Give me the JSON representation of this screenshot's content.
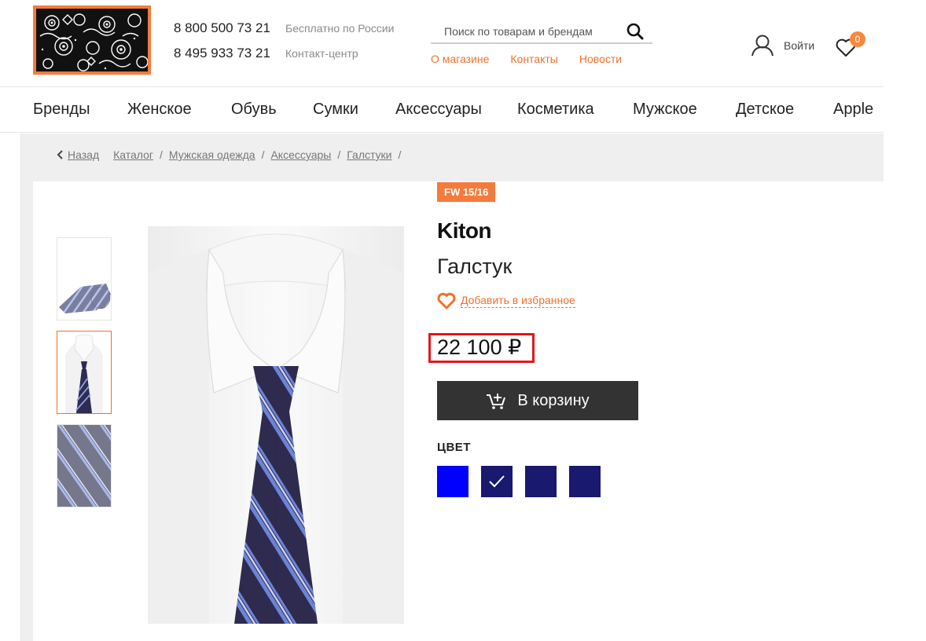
{
  "header": {
    "phones": [
      {
        "number": "8 800 500 73 21",
        "note": "Бесплатно по России"
      },
      {
        "number": "8 495 933 73 21",
        "note": "Контакт-центр"
      }
    ],
    "search": {
      "placeholder": "Поиск по товарам и брендам"
    },
    "links": [
      "О магазине",
      "Контакты",
      "Новости"
    ],
    "login_label": "Войти",
    "favorites_count": "0",
    "accent_color": "#f47b3b"
  },
  "nav": {
    "items": [
      "Бренды",
      "Женское",
      "Обувь",
      "Сумки",
      "Аксессуары",
      "Косметика",
      "Мужское",
      "Детское",
      "Apple"
    ]
  },
  "breadcrumb": {
    "back": "Назад",
    "items": [
      "Каталог",
      "Мужская одежда",
      "Аксессуары",
      "Галстуки"
    ],
    "separator": "/"
  },
  "product": {
    "season": "FW 15/16",
    "brand": "Kiton",
    "name": "Галстук",
    "add_favorite": "Добавить в избранное",
    "price": "22 100 ₽",
    "cart_label": "В корзину",
    "color_label": "ЦВЕТ",
    "colors": [
      {
        "hex": "#0000ff",
        "selected": false
      },
      {
        "hex": "#191970",
        "selected": true
      },
      {
        "hex": "#191970",
        "selected": false
      },
      {
        "hex": "#191970",
        "selected": false
      }
    ],
    "thumbnails": [
      "tie-rolled",
      "tie-on-shirt",
      "fabric-closeup"
    ],
    "active_thumbnail": 1
  }
}
